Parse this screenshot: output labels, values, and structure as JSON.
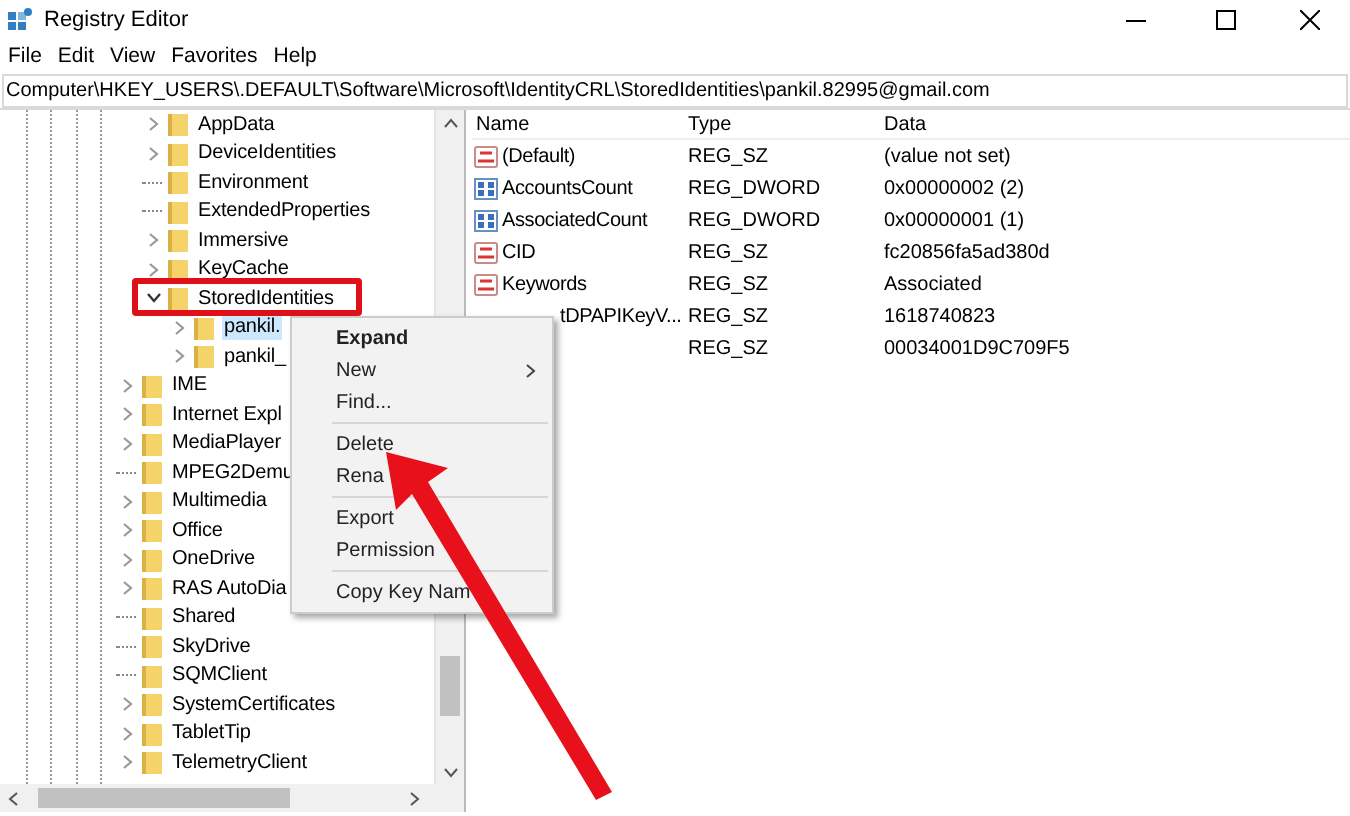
{
  "window": {
    "title": "Registry Editor"
  },
  "menu": [
    "File",
    "Edit",
    "View",
    "Favorites",
    "Help"
  ],
  "address": "Computer\\HKEY_USERS\\.DEFAULT\\Software\\Microsoft\\IdentityCRL\\StoredIdentities\\pankil.82995@gmail.com",
  "tree": {
    "nested_items": [
      {
        "label": "AppData",
        "expandable": true,
        "expanded": false,
        "selected": false
      },
      {
        "label": "DeviceIdentities",
        "expandable": true,
        "expanded": false,
        "selected": false
      },
      {
        "label": "Environment",
        "expandable": false,
        "expanded": false,
        "selected": false
      },
      {
        "label": "ExtendedProperties",
        "expandable": false,
        "expanded": false,
        "selected": false
      },
      {
        "label": "Immersive",
        "expandable": true,
        "expanded": false,
        "selected": false
      },
      {
        "label": "KeyCache",
        "expandable": true,
        "expanded": false,
        "selected": false
      },
      {
        "label": "StoredIdentities",
        "expandable": true,
        "expanded": true,
        "selected": false,
        "children": [
          {
            "label": "pankil.",
            "expandable": true,
            "expanded": false,
            "selected": true
          },
          {
            "label": "pankil_",
            "expandable": true,
            "expanded": false,
            "selected": false
          }
        ]
      }
    ],
    "items": [
      {
        "label": "IME",
        "expandable": true,
        "expanded": false,
        "selected": false
      },
      {
        "label": "Internet Expl",
        "expandable": true,
        "expanded": false,
        "selected": false
      },
      {
        "label": "MediaPlayer",
        "expandable": true,
        "expanded": false,
        "selected": false
      },
      {
        "label": "MPEG2Demu",
        "expandable": false,
        "expanded": false,
        "selected": false
      },
      {
        "label": "Multimedia",
        "expandable": true,
        "expanded": false,
        "selected": false
      },
      {
        "label": "Office",
        "expandable": true,
        "expanded": false,
        "selected": false
      },
      {
        "label": "OneDrive",
        "expandable": true,
        "expanded": false,
        "selected": false
      },
      {
        "label": "RAS AutoDia",
        "expandable": true,
        "expanded": false,
        "selected": false
      },
      {
        "label": "Shared",
        "expandable": false,
        "expanded": false,
        "selected": false
      },
      {
        "label": "SkyDrive",
        "expandable": false,
        "expanded": false,
        "selected": false
      },
      {
        "label": "SQMClient",
        "expandable": false,
        "expanded": false,
        "selected": false
      },
      {
        "label": "SystemCertificates",
        "expandable": true,
        "expanded": false,
        "selected": false
      },
      {
        "label": "TabletTip",
        "expandable": true,
        "expanded": false,
        "selected": false
      },
      {
        "label": "TelemetryClient",
        "expandable": true,
        "expanded": false,
        "selected": false
      }
    ]
  },
  "table": {
    "columns": [
      "Name",
      "Type",
      "Data"
    ],
    "rows": [
      {
        "kind": "string",
        "name": "(Default)",
        "type": "REG_SZ",
        "data": "(value not set)"
      },
      {
        "kind": "binary",
        "name": "AccountsCount",
        "type": "REG_DWORD",
        "data": "0x00000002 (2)"
      },
      {
        "kind": "binary",
        "name": "AssociatedCount",
        "type": "REG_DWORD",
        "data": "0x00000001 (1)"
      },
      {
        "kind": "string",
        "name": "CID",
        "type": "REG_SZ",
        "data": "fc20856fa5ad380d"
      },
      {
        "kind": "string",
        "name": "Keywords",
        "type": "REG_SZ",
        "data": "Associated"
      },
      {
        "kind": "covered",
        "name": "tDPAPIKeyV...",
        "type": "REG_SZ",
        "data": "1618740823"
      },
      {
        "kind": "covered",
        "type": "REG_SZ",
        "data": "00034001D9C709F5"
      }
    ]
  },
  "context_menu": {
    "groups": [
      [
        {
          "label": "Expand",
          "bold": true,
          "submenu": false
        },
        {
          "label": "New",
          "bold": false,
          "submenu": true
        },
        {
          "label": "Find...",
          "bold": false,
          "submenu": false
        }
      ],
      [
        {
          "label": "Delete",
          "bold": false,
          "submenu": false
        },
        {
          "label": "Rena",
          "bold": false,
          "submenu": false
        }
      ],
      [
        {
          "label": "Export",
          "bold": false,
          "submenu": false
        },
        {
          "label": "Permission",
          "bold": false,
          "submenu": false
        }
      ],
      [
        {
          "label": "Copy Key Nam",
          "bold": false,
          "submenu": false
        }
      ]
    ]
  }
}
